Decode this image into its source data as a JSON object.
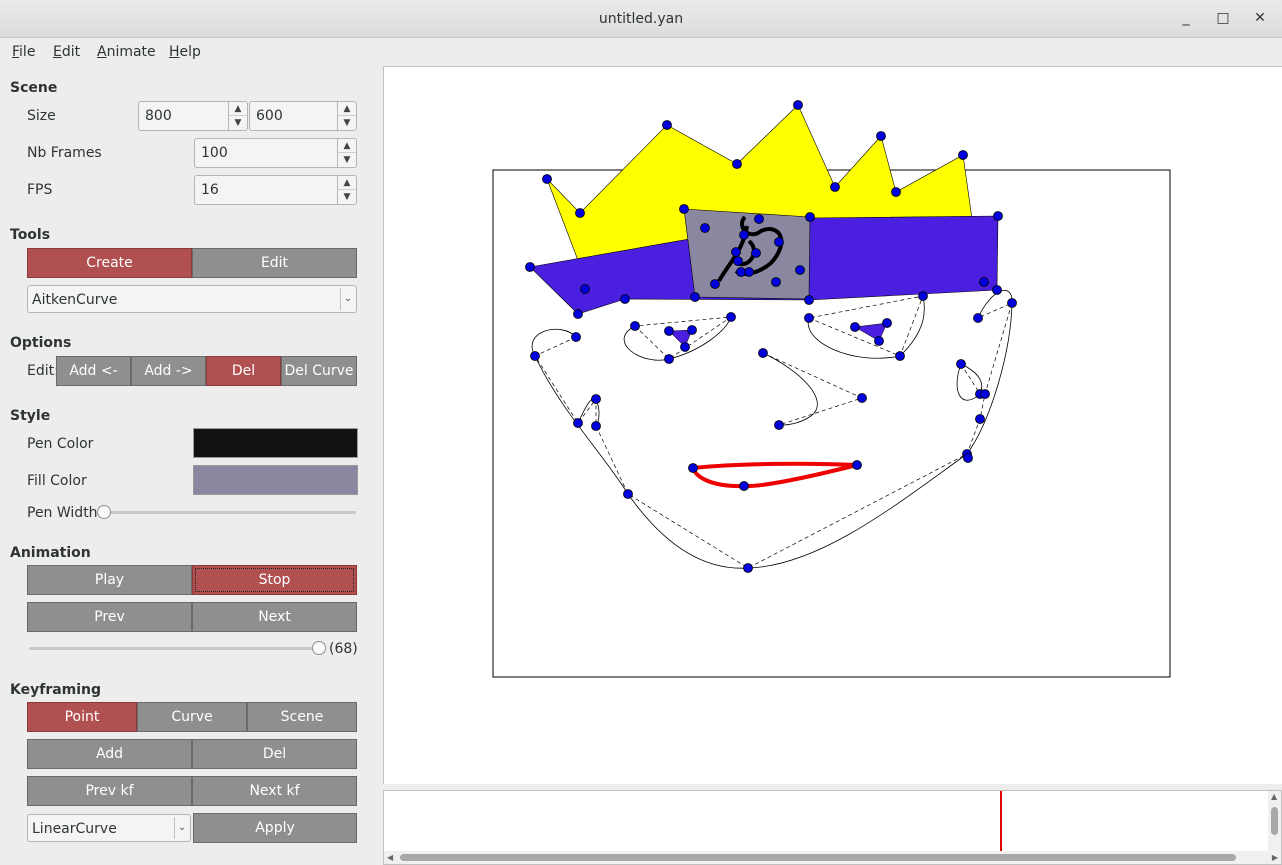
{
  "window": {
    "title": "untitled.yan"
  },
  "menu": {
    "file": "File",
    "edit": "Edit",
    "animate": "Animate",
    "help": "Help"
  },
  "scene": {
    "heading": "Scene",
    "size_label": "Size",
    "width": "800",
    "height": "600",
    "frames_label": "Nb Frames",
    "frames": "100",
    "fps_label": "FPS",
    "fps": "16"
  },
  "tools": {
    "heading": "Tools",
    "create": "Create",
    "edit": "Edit",
    "curve_type": "AitkenCurve"
  },
  "options": {
    "heading": "Options",
    "edit_label": "Edit:",
    "add_left": "Add <-",
    "add_right": "Add ->",
    "del": "Del",
    "del_curve": "Del Curve"
  },
  "style": {
    "heading": "Style",
    "pen_color_label": "Pen Color",
    "pen_color": "#111111",
    "fill_color_label": "Fill Color",
    "fill_color": "#8a87a0",
    "pen_width_label": "Pen Width",
    "pen_width_level": 0
  },
  "animation": {
    "heading": "Animation",
    "play": "Play",
    "stop": "Stop",
    "prev": "Prev",
    "next": "Next",
    "frame_value": "(68)",
    "frame_level": 1.0
  },
  "keyframing": {
    "heading": "Keyframing",
    "point": "Point",
    "curve": "Curve",
    "scene": "Scene",
    "add": "Add",
    "del": "Del",
    "prev_kf": "Prev kf",
    "next_kf": "Next kf",
    "interp": "LinearCurve",
    "apply": "Apply"
  },
  "colors": {
    "accent_red": "#b05050",
    "button_gray": "#8f8f8f",
    "control_point": "#0000dd",
    "crown": "#ffff00",
    "band": "#4a1fe0",
    "mouth": "#ee0000",
    "timeline_marker": "#e00000"
  },
  "timeline": {
    "current_frame": 68
  }
}
